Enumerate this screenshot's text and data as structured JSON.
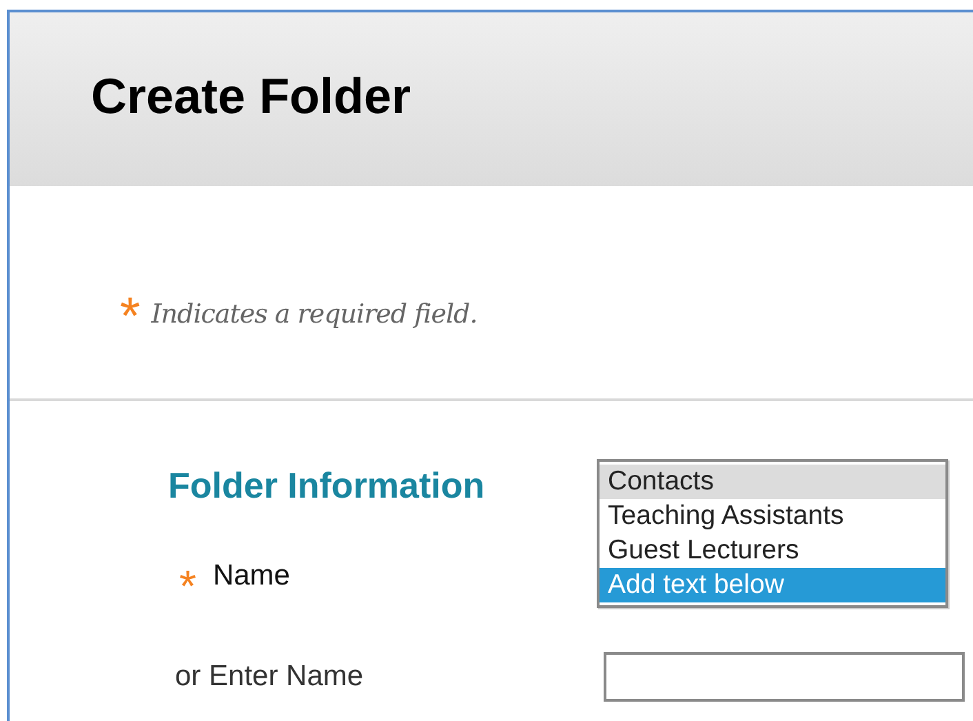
{
  "page": {
    "title": "Create Folder"
  },
  "required_note": {
    "marker": "*",
    "text": "Indicates a required field."
  },
  "section": {
    "title": "Folder Information"
  },
  "name_field": {
    "label": "Name",
    "required_marker": "*",
    "options": [
      {
        "label": "Contacts",
        "selected": false,
        "hovered": true
      },
      {
        "label": "Teaching Assistants",
        "selected": false,
        "hovered": false
      },
      {
        "label": "Guest Lecturers",
        "selected": false,
        "hovered": false
      },
      {
        "label": "Add text below",
        "selected": true,
        "hovered": false
      }
    ]
  },
  "enter_name_field": {
    "label": "or Enter Name"
  }
}
